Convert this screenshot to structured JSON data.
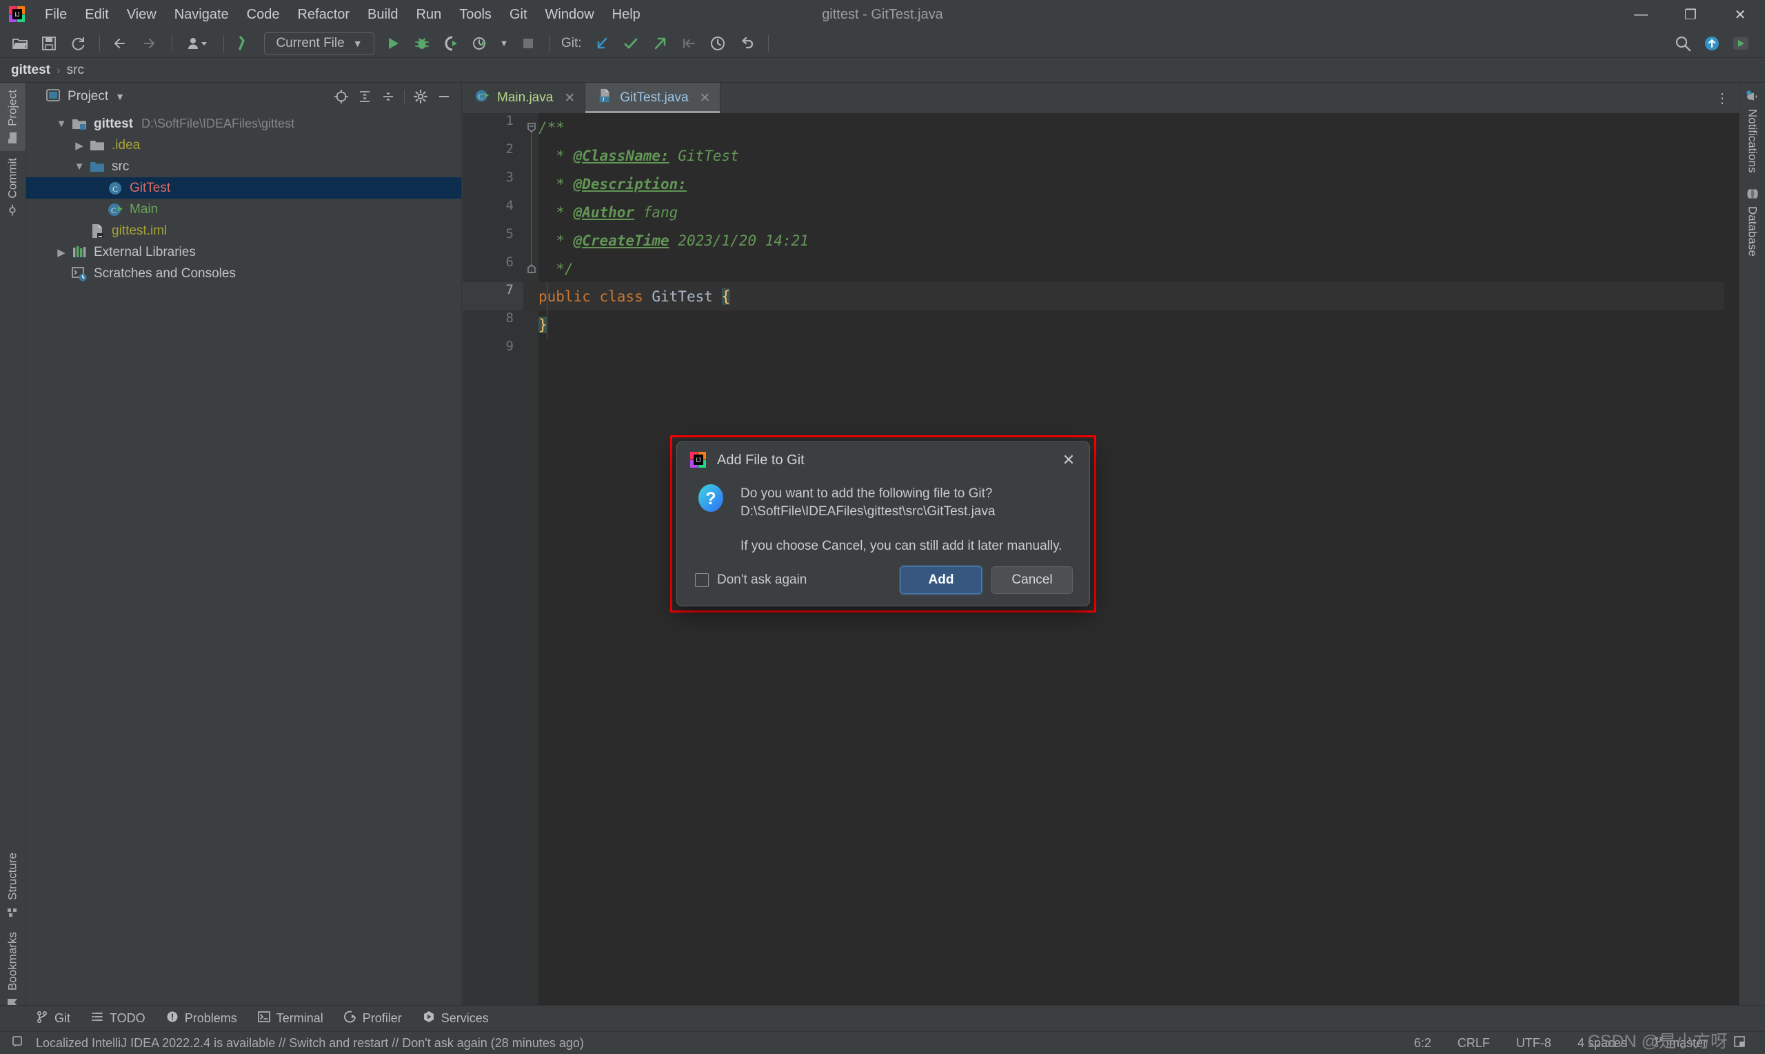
{
  "window": {
    "title": "gittest - GitTest.java",
    "minimize_label": "—",
    "maximize_label": "❐",
    "close_label": "✕"
  },
  "menu": [
    {
      "label": "File",
      "accel": "F"
    },
    {
      "label": "Edit",
      "accel": "E"
    },
    {
      "label": "View",
      "accel": "V"
    },
    {
      "label": "Navigate",
      "accel": "N"
    },
    {
      "label": "Code",
      "accel": "C"
    },
    {
      "label": "Refactor",
      "accel": "R"
    },
    {
      "label": "Build",
      "accel": "B"
    },
    {
      "label": "Run",
      "accel": "u"
    },
    {
      "label": "Tools",
      "accel": "T"
    },
    {
      "label": "Git",
      "accel": "G"
    },
    {
      "label": "Window",
      "accel": "W"
    },
    {
      "label": "Help",
      "accel": "H"
    }
  ],
  "toolbar": {
    "open_icon": "open-folder-icon",
    "save_icon": "save-icon",
    "sync_icon": "refresh-icon",
    "back_icon": "arrow-left-icon",
    "forward_icon": "arrow-right-icon",
    "profile_icon": "user-profile-icon",
    "build_icon": "build-hammer-icon",
    "run_config": "Current File",
    "run_icon": "run-play-icon",
    "debug_icon": "debug-bug-icon",
    "coverage_icon": "run-with-coverage-icon",
    "profiler_icon": "profiler-clock-icon",
    "stop_icon": "stop-square-icon",
    "git_label": "Git:",
    "git_update_icon": "git-update-arrow-icon",
    "git_commit_icon": "git-commit-check-icon",
    "git_push_icon": "git-push-arrow-icon",
    "git_pull_icon": "git-pull-arrow-icon",
    "git_history_icon": "git-history-clock-icon",
    "git_rollback_icon": "git-rollback-undo-icon",
    "search_icon": "search-icon",
    "update_icon": "update-available-icon",
    "ide_run_icon": "ide-run-icon"
  },
  "breadcrumb": {
    "project": "gittest",
    "separator": "›",
    "folder": "src"
  },
  "left_stripe": {
    "top": [
      {
        "label": "Project",
        "icon": "project-folder-icon",
        "active": true
      },
      {
        "label": "Commit",
        "icon": "git-commit-node-icon",
        "active": false
      }
    ],
    "bottom": [
      {
        "label": "Structure",
        "icon": "structure-blocks-icon"
      },
      {
        "label": "Bookmarks",
        "icon": "bookmark-icon"
      }
    ]
  },
  "right_stripe": {
    "items": [
      {
        "label": "Notifications",
        "icon": "notification-bell-icon",
        "badge": true
      },
      {
        "label": "Database",
        "icon": "database-cylinder-icon",
        "badge": false
      }
    ]
  },
  "project_panel": {
    "title": "Project",
    "dropdown_icon": "chevron-down-icon",
    "tools": [
      {
        "name": "select-opened-file-icon",
        "glyph": "⊕"
      },
      {
        "name": "expand-all-icon",
        "glyph": "⇵"
      },
      {
        "name": "collapse-all-icon",
        "glyph": "⇶"
      },
      {
        "name": "settings-gear-icon",
        "glyph": "⚙"
      },
      {
        "name": "hide-panel-icon",
        "glyph": "—"
      }
    ],
    "tree": [
      {
        "id": "gittest-root",
        "label": "gittest",
        "path": "D:\\SoftFile\\IDEAFiles\\gittest",
        "depth": 0,
        "twist": "down",
        "icon": "module-folder-icon",
        "style": "bold",
        "selected": false
      },
      {
        "id": "idea-folder",
        "label": ".idea",
        "path": "",
        "depth": 1,
        "twist": "right",
        "icon": "folder-icon",
        "style": "olive",
        "selected": false
      },
      {
        "id": "src-folder",
        "label": "src",
        "path": "",
        "depth": 1,
        "twist": "down",
        "icon": "source-folder-icon",
        "style": "normal",
        "selected": false
      },
      {
        "id": "gittest-class",
        "label": "GitTest",
        "path": "",
        "depth": 2,
        "twist": "none",
        "icon": "java-class-icon",
        "style": "red",
        "selected": true
      },
      {
        "id": "main-class",
        "label": "Main",
        "path": "",
        "depth": 2,
        "twist": "none",
        "icon": "java-runnable-class-icon",
        "style": "green",
        "selected": false
      },
      {
        "id": "iml-file",
        "label": "gittest.iml",
        "path": "",
        "depth": 1,
        "twist": "none",
        "icon": "iml-file-icon",
        "style": "olive",
        "selected": false
      },
      {
        "id": "external-libraries",
        "label": "External Libraries",
        "path": "",
        "depth": 0,
        "twist": "right",
        "icon": "libraries-icon",
        "style": "normal",
        "selected": false
      },
      {
        "id": "scratches",
        "label": "Scratches and Consoles",
        "path": "",
        "depth": 0,
        "twist": "none",
        "icon": "scratches-icon",
        "style": "normal",
        "selected": false
      }
    ]
  },
  "editor": {
    "tabs": [
      {
        "label": "Main.java",
        "icon": "java-runnable-class-icon",
        "active": false,
        "close_glyph": "✕"
      },
      {
        "label": "GitTest.java",
        "icon": "java-file-added-icon",
        "active": true,
        "close_glyph": "✕"
      }
    ],
    "more_glyph": "⋮",
    "lines": [
      {
        "n": "1",
        "segments": [
          {
            "t": "/**",
            "c": "doc"
          }
        ]
      },
      {
        "n": "2",
        "segments": [
          {
            "t": "  * ",
            "c": "doc"
          },
          {
            "t": "@ClassName:",
            "c": "doc-tag"
          },
          {
            "t": " GitTest",
            "c": "doc"
          }
        ]
      },
      {
        "n": "3",
        "segments": [
          {
            "t": "  * ",
            "c": "doc"
          },
          {
            "t": "@Description:",
            "c": "doc-tag"
          }
        ]
      },
      {
        "n": "4",
        "segments": [
          {
            "t": "  * ",
            "c": "doc"
          },
          {
            "t": "@Author",
            "c": "doc-tag"
          },
          {
            "t": " fang",
            "c": "doc"
          }
        ]
      },
      {
        "n": "5",
        "segments": [
          {
            "t": "  * ",
            "c": "doc"
          },
          {
            "t": "@CreateTime",
            "c": "doc-tag"
          },
          {
            "t": " 2023/1/20 14:21",
            "c": "doc"
          }
        ]
      },
      {
        "n": "6",
        "segments": [
          {
            "t": "  */",
            "c": "doc"
          }
        ]
      },
      {
        "n": "7",
        "segments": [
          {
            "t": "public class ",
            "c": "kw"
          },
          {
            "t": "GitTest ",
            "c": "cls"
          },
          {
            "t": "{",
            "c": "brace-hl"
          }
        ]
      },
      {
        "n": "8",
        "segments": [
          {
            "t": "}",
            "c": "brace-hl"
          }
        ]
      },
      {
        "n": "9",
        "segments": []
      }
    ]
  },
  "dialog": {
    "icon": "intellij-idea-logo-icon",
    "title": "Add File to Git",
    "close_glyph": "✕",
    "question_icon": "question-mark-icon",
    "message_line1": "Do you want to add the following file to Git?",
    "message_line2": "D:\\SoftFile\\IDEAFiles\\gittest\\src\\GitTest.java",
    "note": "If you choose Cancel, you can still add it later manually.",
    "checkbox_label": "Don't ask again",
    "checkbox_checked": false,
    "add_label": "Add",
    "cancel_label": "Cancel",
    "highlight_color": "#ff0000",
    "primary_color": "#365880"
  },
  "tool_windows": [
    {
      "label": "Git",
      "icon": "git-branch-icon"
    },
    {
      "label": "TODO",
      "icon": "todo-list-icon"
    },
    {
      "label": "Problems",
      "icon": "problems-warning-icon"
    },
    {
      "label": "Terminal",
      "icon": "terminal-icon"
    },
    {
      "label": "Profiler",
      "icon": "profiler-icon"
    },
    {
      "label": "Services",
      "icon": "services-play-icon"
    }
  ],
  "status_bar": {
    "notice_icon": "notification-balloon-icon",
    "notice": "Localized IntelliJ IDEA 2022.2.4 is available // Switch and restart // Don't ask again (28 minutes ago)",
    "caret_position": "6:2",
    "line_separator": "CRLF",
    "encoding": "UTF-8",
    "indent": "4 spaces",
    "branch_icon": "git-branch-icon",
    "branch": "master",
    "layout_icon": "layout-icon"
  },
  "watermark": "CSDN @是小方呀"
}
